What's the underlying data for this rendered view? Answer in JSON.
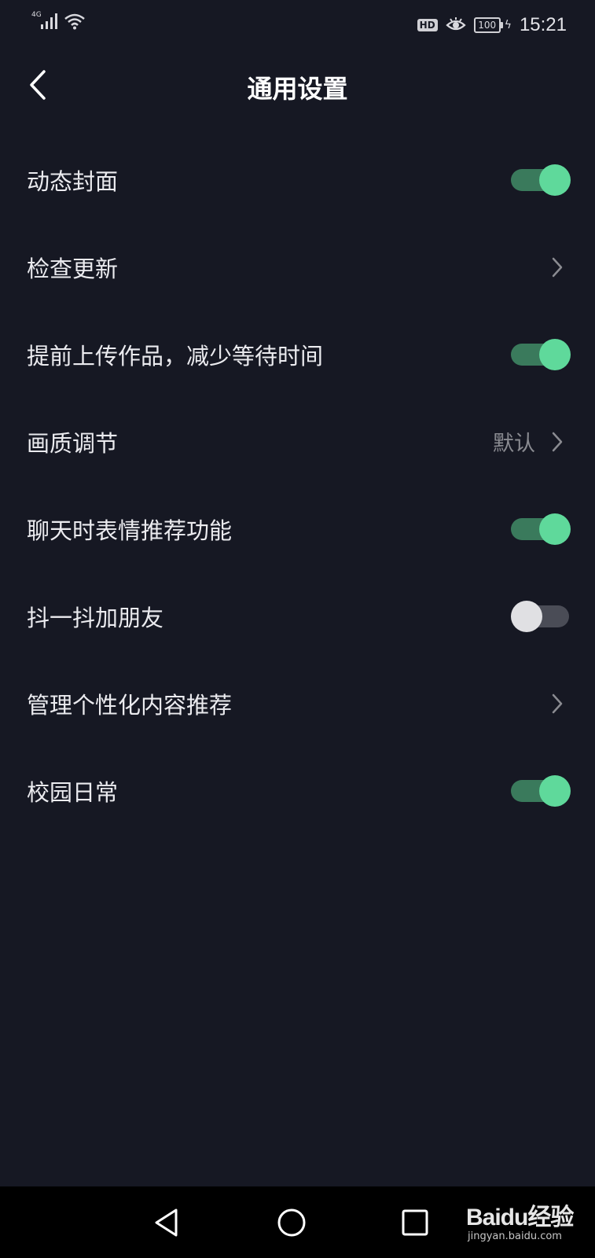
{
  "status_bar": {
    "network_label": "4G",
    "hd_badge": "HD",
    "battery_level": "100",
    "time": "15:21"
  },
  "header": {
    "title": "通用设置"
  },
  "settings": [
    {
      "label": "动态封面",
      "type": "toggle",
      "state": "on"
    },
    {
      "label": "检查更新",
      "type": "link"
    },
    {
      "label": "提前上传作品，减少等待时间",
      "type": "toggle",
      "state": "on"
    },
    {
      "label": "画质调节",
      "type": "link",
      "value": "默认"
    },
    {
      "label": "聊天时表情推荐功能",
      "type": "toggle",
      "state": "on"
    },
    {
      "label": "抖一抖加朋友",
      "type": "toggle",
      "state": "off"
    },
    {
      "label": "管理个性化内容推荐",
      "type": "link"
    },
    {
      "label": "校园日常",
      "type": "toggle",
      "state": "on"
    }
  ],
  "colors": {
    "background": "#161823",
    "toggle_on": "#5fd99b",
    "toggle_off": "#e0e0e3"
  },
  "watermark": {
    "logo": "Baidu经验",
    "url": "jingyan.baidu.com"
  }
}
